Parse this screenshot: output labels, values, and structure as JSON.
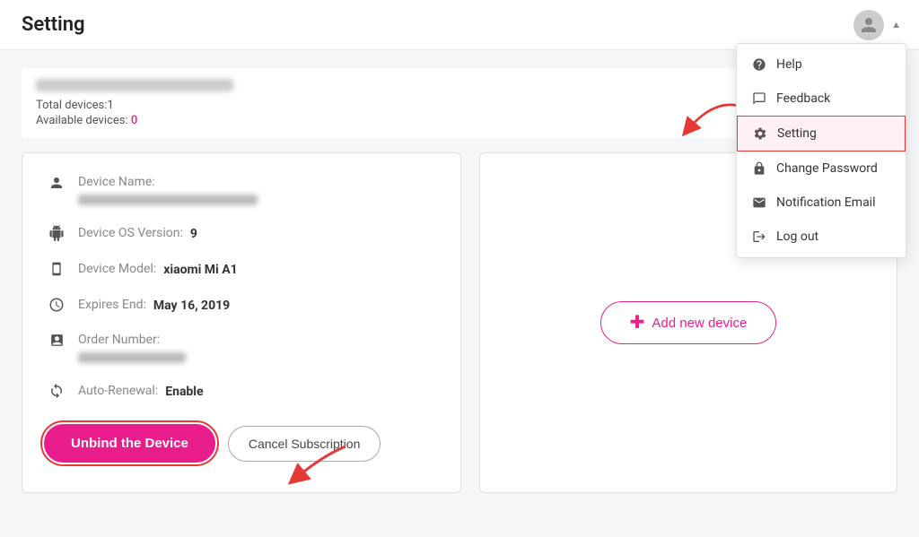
{
  "header": {
    "title": "Setting"
  },
  "userInfo": {
    "totalDevices": "Total devices:1",
    "availableDevices": "Available devices:",
    "availableCount": "0"
  },
  "deviceCard": {
    "deviceNameLabel": "Device Name:",
    "deviceOSLabel": "Device OS Version:",
    "deviceOSValue": "9",
    "deviceModelLabel": "Device Model:",
    "deviceModelValue": "xiaomi Mi A1",
    "expiresLabel": "Expires End:",
    "expiresValue": "May 16, 2019",
    "orderNumberLabel": "Order Number:",
    "autoRenewalLabel": "Auto-Renewal:",
    "autoRenewalValue": "Enable",
    "unbindButton": "Unbind the Device",
    "cancelButton": "Cancel Subscription"
  },
  "rightPanel": {
    "addNewDevice": "Add new device"
  },
  "dropdown": {
    "items": [
      {
        "id": "help",
        "label": "Help",
        "icon": "help"
      },
      {
        "id": "feedback",
        "label": "Feedback",
        "icon": "feedback"
      },
      {
        "id": "setting",
        "label": "Setting",
        "icon": "setting",
        "active": true
      },
      {
        "id": "changePassword",
        "label": "Change Password",
        "icon": "lock"
      },
      {
        "id": "notificationEmail",
        "label": "Notification Email",
        "icon": "email"
      },
      {
        "id": "logout",
        "label": "Log out",
        "icon": "logout"
      }
    ]
  }
}
